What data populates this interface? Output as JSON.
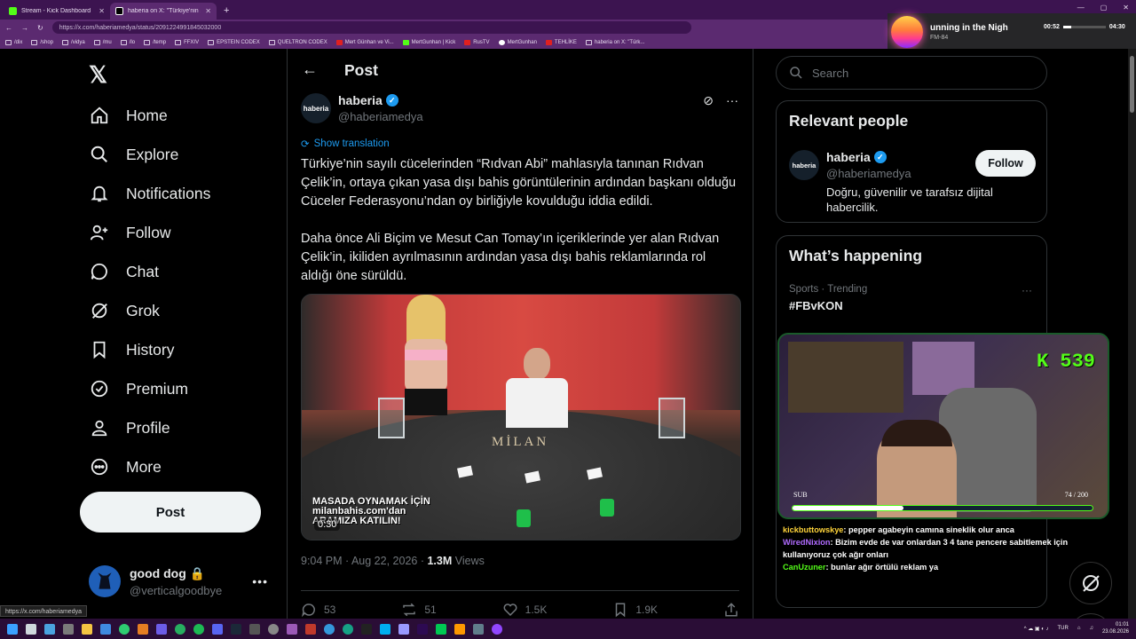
{
  "browser": {
    "tabs": [
      {
        "title": "Stream - Kick Dashboard",
        "active": false,
        "icon_color": "#53fc18"
      },
      {
        "title": "haberia on X: \"Türkiye'nin sayılı cü",
        "active": true,
        "icon_color": "#ffffff"
      }
    ],
    "new_tab": "+",
    "url": "https://x.com/haberiamedya/status/2091224991845032000",
    "window_controls": [
      "—",
      "▢",
      "✕"
    ],
    "bookmarks": [
      "/dix",
      "/shop",
      "/vidya",
      "/mu",
      "/lo",
      "/temp",
      "FFXIV",
      "EPSTEIN CODEX",
      "QUELTRON CODEX",
      "Mert Günhan ve Vi...",
      "MertGunhan | Kick",
      "RusTV",
      "MertGunhan",
      "TEHLİKE",
      "haberia on X: \"Türk..."
    ]
  },
  "music": {
    "title": "unning in the Nigh",
    "artist": "FM-84",
    "elapsed": "00:52",
    "total": "04:30",
    "progress": 0.19
  },
  "nav": {
    "items": [
      {
        "label": "Home",
        "icon": "home-icon"
      },
      {
        "label": "Explore",
        "icon": "search-icon"
      },
      {
        "label": "Notifications",
        "icon": "bell-icon"
      },
      {
        "label": "Follow",
        "icon": "follow-icon"
      },
      {
        "label": "Chat",
        "icon": "chat-icon"
      },
      {
        "label": "Grok",
        "icon": "grok-icon"
      },
      {
        "label": "History",
        "icon": "bookmark-icon"
      },
      {
        "label": "Premium",
        "icon": "premium-icon"
      },
      {
        "label": "Profile",
        "icon": "person-icon"
      },
      {
        "label": "More",
        "icon": "more-icon"
      }
    ],
    "post_button": "Post",
    "account": {
      "name": "good dog",
      "handle": "@verticalgoodbye"
    }
  },
  "main": {
    "header_title": "Post",
    "author": {
      "name": "haberia",
      "handle": "@haberiamedya",
      "avatar_text": "haberia"
    },
    "show_translation": "Show translation",
    "paragraphs": [
      "Türkiye’nin sayılı cücelerinden “Rıdvan Abi” mahlasıyla tanınan Rıdvan Çelik’in, ortaya çıkan yasa dışı bahis görüntülerinin ardından başkanı olduğu Cüceler Federasyonu’ndan oy birliğiyle kovulduğu iddia edildi.",
      "Daha önce Ali Biçim ve Mesut Can Tomay’ın içeriklerinde yer alan Rıdvan Çelik’in, ikiliden ayrılmasının ardından yasa dışı bahis reklamlarında rol aldığı öne sürüldü."
    ],
    "video": {
      "table_logo": "MİLAN",
      "overlay_line1": "MASADA OYNAMAK İÇİN",
      "overlay_line2": "milanbahis.com'dan",
      "overlay_line3": "ARAMIZA KATILIN!",
      "time": "0:30"
    },
    "meta": {
      "time": "9:04 PM · Aug 22, 2026 · ",
      "views": "1.3M",
      "views_label": " Views"
    },
    "actions": {
      "replies": "53",
      "reposts": "51",
      "likes": "1.5K",
      "bookmarks": "1.9K"
    }
  },
  "right": {
    "search_placeholder": "Search",
    "relevant": {
      "title": "Relevant people",
      "name": "haberia",
      "handle": "@haberiamedya",
      "avatar_text": "haberia",
      "bio": "Doğru, güvenilir ve tarafsız dijital habercilik.",
      "follow": "Follow"
    },
    "happening": {
      "title": "What’s happening",
      "trend_meta": "Sports · Trending",
      "trend_tag": "#FBvKON"
    }
  },
  "stream": {
    "kick_count": "539",
    "sub_label": "SUB",
    "sub_count": "74 / 200",
    "sub_progress": 0.37,
    "chat": [
      {
        "user": "kickbuttowskye",
        "text": ": pepper agabeyin camına sineklik olur anca"
      },
      {
        "user": "WiredNixion",
        "text": ": Bizim evde de var onlardan 3 4 tane pencere sabitlemek için kullanıyoruz çok ağır onları"
      },
      {
        "user": "CanUzuner",
        "text": ": bunlar ağır örtülü reklam ya"
      }
    ]
  },
  "status_url": "https://x.com/haberiamedya",
  "taskbar": {
    "lang": "TUR",
    "time": "01:01",
    "date": "23.08.2026"
  }
}
